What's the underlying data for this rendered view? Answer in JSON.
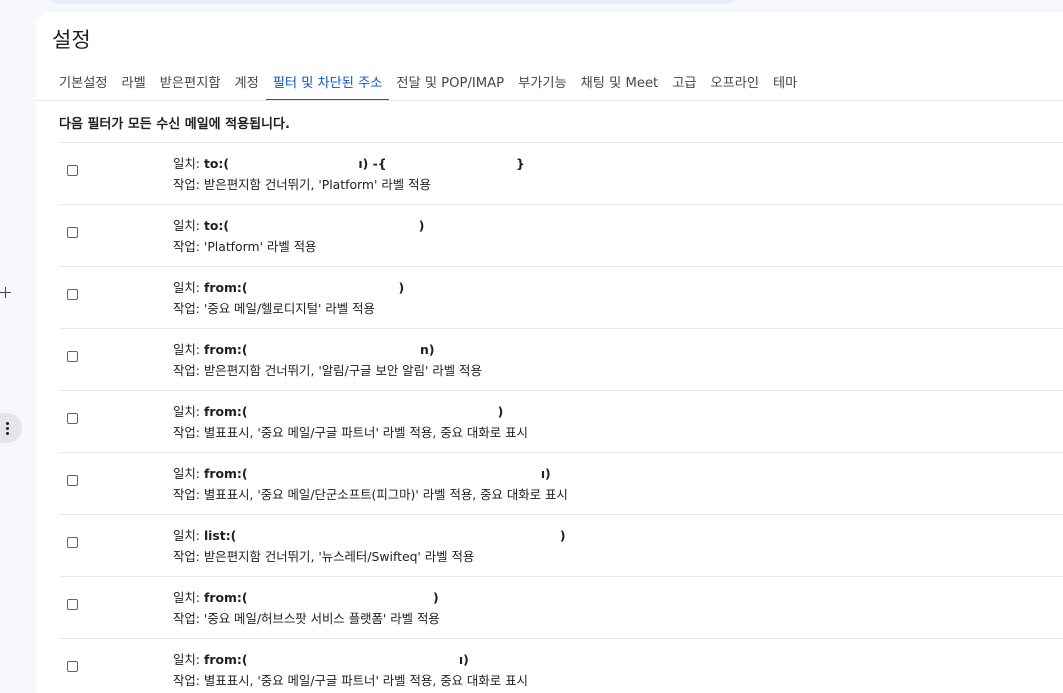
{
  "page": {
    "title": "설정"
  },
  "tabs": [
    {
      "label": "기본설정",
      "active": false
    },
    {
      "label": "라벨",
      "active": false
    },
    {
      "label": "받은편지함",
      "active": false
    },
    {
      "label": "계정",
      "active": false
    },
    {
      "label": "필터 및 차단된 주소",
      "active": true
    },
    {
      "label": "전달 및 POP/IMAP",
      "active": false
    },
    {
      "label": "부가기능",
      "active": false
    },
    {
      "label": "채팅 및 Meet",
      "active": false
    },
    {
      "label": "고급",
      "active": false
    },
    {
      "label": "오프라인",
      "active": false
    },
    {
      "label": "테마",
      "active": false
    }
  ],
  "filters_header": "다음 필터가 모든 수신 메일에 적용됩니다.",
  "filters": [
    {
      "match_label": "일치:",
      "criteria": "to:(                              ı) -{                              }",
      "action": "작업: 받은편지함 건너뛰기, 'Platform' 라벨 적용"
    },
    {
      "match_label": "일치:",
      "criteria": "to:(                                            )",
      "action": "작업: 'Platform' 라벨 적용"
    },
    {
      "match_label": "일치:",
      "criteria": "from:(                                   )",
      "action": "작업: '중요 메일/헬로디지털' 라벨 적용"
    },
    {
      "match_label": "일치:",
      "criteria": "from:(                                        n)",
      "action": "작업: 받은편지함 건너뛰기, '알림/구글 보안 알림' 라벨 적용"
    },
    {
      "match_label": "일치:",
      "criteria": "from:(                                                          )",
      "action": "작업: 별표표시, '중요 메일/구글 파트너' 라벨 적용, 중요 대화로 표시"
    },
    {
      "match_label": "일치:",
      "criteria": "from:(                                                                    ı)",
      "action": "작업: 별표표시, '중요 메일/단군소프트(피그마)' 라벨 적용, 중요 대화로 표시"
    },
    {
      "match_label": "일치:",
      "criteria": "list:(                                                                           )",
      "action": "작업: 받은편지함 건너뛰기, '뉴스레터/Swifteq' 라벨 적용"
    },
    {
      "match_label": "일치:",
      "criteria": "from:(                                           )",
      "action": "작업: '중요 메일/허브스팟 서비스 플랫폼' 라벨 적용"
    },
    {
      "match_label": "일치:",
      "criteria": "from:(                                                 ı)",
      "action": "작업: 별표표시, '중요 메일/구글 파트너' 라벨 적용, 중요 대화로 표시"
    }
  ]
}
